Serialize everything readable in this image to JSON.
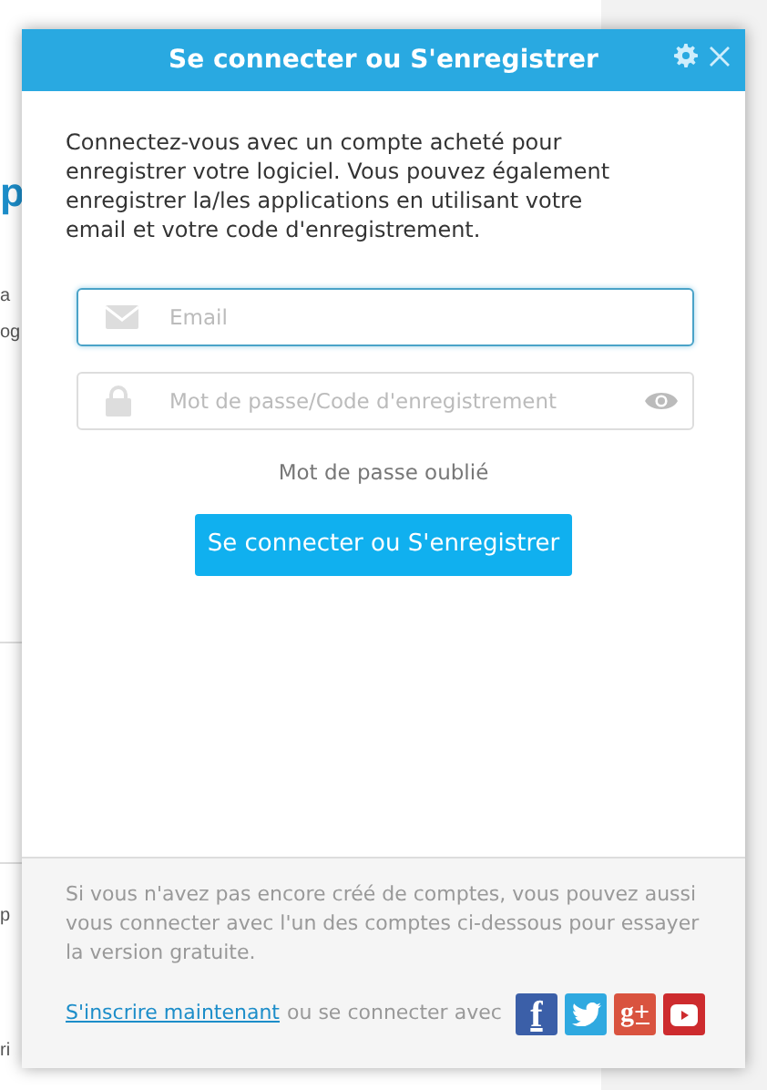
{
  "background": {
    "fragments": [
      {
        "text": "p",
        "kind": "heading"
      },
      {
        "text": "a",
        "kind": "body"
      },
      {
        "text": "og",
        "kind": "body"
      },
      {
        "text": "p",
        "kind": "body"
      },
      {
        "text": "ri",
        "kind": "body"
      }
    ]
  },
  "dialog": {
    "title": "Se connecter ou S'enregistrer",
    "intro": "Connectez-vous avec un compte acheté pour enregistrer votre logiciel. Vous pouvez également enregistrer la/les applications en utilisant votre email et votre code d'enregistrement.",
    "email": {
      "placeholder": "Email",
      "focused": true
    },
    "password": {
      "placeholder": "Mot de passe/Code d'enregistrement"
    },
    "forgot_link": "Mot de passe oublié",
    "submit_button": "Se connecter ou S'enregistrer",
    "footer_text": "Si vous n'avez pas encore créé de comptes, vous pouvez aussi vous connecter avec l'un des comptes ci-dessous pour essayer la version gratuite.",
    "signup_link": "S'inscrire maintenant",
    "signup_suffix": "ou se connecter avec",
    "social": [
      {
        "kind": "facebook",
        "glyph": "f",
        "color": "#3b5fa8"
      },
      {
        "kind": "twitter",
        "color": "#2fa9e0"
      },
      {
        "kind": "google",
        "glyph": "g+",
        "color": "#d9533f"
      },
      {
        "kind": "youtube",
        "color": "#cd2b2e"
      }
    ]
  }
}
